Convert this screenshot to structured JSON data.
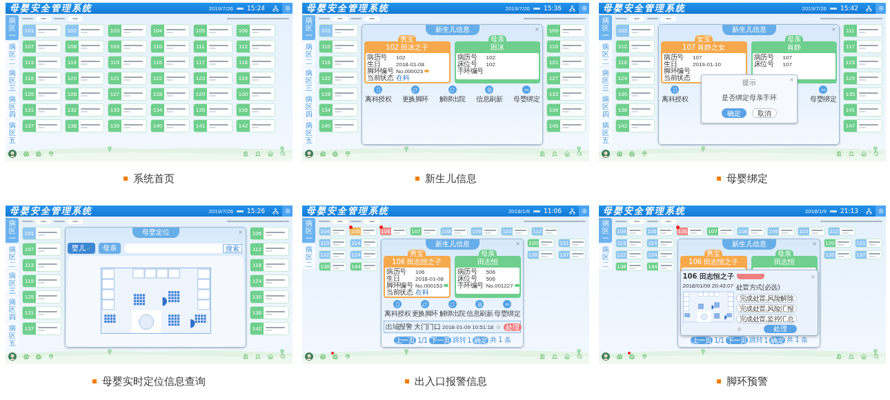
{
  "screens": [
    {
      "caption": "系统首页",
      "header": {
        "title": "母婴安全管理系统",
        "date": "2019/7/26",
        "time": "15:24"
      },
      "nav_alert": false,
      "wards": [
        {
          "label": "病区一",
          "selected": true
        },
        {
          "label": "病区二",
          "selected": false
        },
        {
          "label": "病区三",
          "selected": false
        },
        {
          "label": "病区四",
          "selected": false
        },
        {
          "label": "病区五",
          "selected": false
        }
      ],
      "left_columns": [
        [
          {
            "number": "101",
            "kind": "bound"
          },
          {
            "number": "107",
            "kind": "unbound"
          },
          {
            "number": "113",
            "kind": "unbound"
          },
          {
            "number": "119",
            "kind": "unbound"
          },
          {
            "number": "125",
            "kind": "unbound"
          },
          {
            "number": "131",
            "kind": "unbound"
          },
          {
            "number": "137",
            "kind": "unbound"
          }
        ],
        [
          {
            "number": "102",
            "kind": "bound"
          },
          {
            "number": "108",
            "kind": "unbound"
          },
          {
            "number": "114",
            "kind": "unbound"
          },
          {
            "number": "120",
            "kind": "unbound"
          },
          {
            "number": "126",
            "kind": "unbound"
          },
          {
            "number": "132",
            "kind": "unbound"
          },
          {
            "number": "138",
            "kind": "unbound"
          }
        ],
        [
          {
            "number": "103",
            "kind": "unbound"
          },
          {
            "number": "109",
            "kind": "unbound"
          },
          {
            "number": "115",
            "kind": "unbound"
          },
          {
            "number": "121",
            "kind": "unbound"
          },
          {
            "number": "127",
            "kind": "unbound"
          },
          {
            "number": "133",
            "kind": "unbound"
          },
          {
            "number": "139",
            "kind": "unbound"
          }
        ],
        [
          {
            "number": "104",
            "kind": "unbound"
          },
          {
            "number": "110",
            "kind": "unbound"
          },
          {
            "number": "116",
            "kind": "unbound"
          },
          {
            "number": "122",
            "kind": "unbound"
          },
          {
            "number": "128",
            "kind": "unbound"
          },
          {
            "number": "134",
            "kind": "unbound"
          },
          {
            "number": "140",
            "kind": "unbound"
          }
        ],
        [
          {
            "number": "105",
            "kind": "unbound"
          },
          {
            "number": "111",
            "kind": "unbound"
          },
          {
            "number": "117",
            "kind": "unbound"
          },
          {
            "number": "123",
            "kind": "unbound"
          },
          {
            "number": "129",
            "kind": "unbound"
          },
          {
            "number": "135",
            "kind": "unbound"
          },
          {
            "number": "141",
            "kind": "unbound"
          }
        ],
        [
          {
            "number": "106",
            "kind": "unbound"
          },
          {
            "number": "112",
            "kind": "unbound"
          },
          {
            "number": "118",
            "kind": "unbound"
          },
          {
            "number": "124",
            "kind": "unbound"
          },
          {
            "number": "130",
            "kind": "unbound"
          },
          {
            "number": "136",
            "kind": "unbound"
          },
          {
            "number": "142",
            "kind": "unbound"
          }
        ]
      ]
    },
    {
      "caption": "新生儿信息",
      "header": {
        "title": "母婴安全管理系统",
        "date": "2019/7/26",
        "time": "15:36"
      },
      "nav_alert": false,
      "wards": [
        {
          "label": "病区一",
          "selected": true
        },
        {
          "label": "病区二",
          "selected": false
        },
        {
          "label": "病区三",
          "selected": false
        },
        {
          "label": "病区四",
          "selected": false
        },
        {
          "label": "病区五",
          "selected": false
        }
      ],
      "left_columns": [
        [
          {
            "number": "101",
            "kind": "bound"
          },
          {
            "number": "110",
            "kind": "unbound"
          },
          {
            "number": "116",
            "kind": "unbound"
          },
          {
            "number": "122",
            "kind": "unbound"
          },
          {
            "number": "128",
            "kind": "unbound"
          },
          {
            "number": "134",
            "kind": "unbound"
          },
          {
            "number": "140",
            "kind": "unbound"
          }
        ]
      ],
      "dialog": {
        "kind": "newborn",
        "title": "新生儿信息",
        "baby": {
          "badge": "男宝",
          "name": "102 田冰之子",
          "fields": [
            {
              "label": "病历号",
              "value": "102"
            },
            {
              "label": "生日",
              "value": "2018-01-08"
            },
            {
              "label": "脚环编号",
              "value": "No.000023",
              "toggle_on": false
            },
            {
              "label": "当前状态",
              "value": "在科",
              "kind": "status"
            }
          ]
        },
        "mother": {
          "badge": "母亲",
          "name": "田冰",
          "fields": [
            {
              "label": "病历号",
              "value": "102"
            },
            {
              "label": "床位号",
              "value": "102"
            },
            {
              "label": "手环编号"
            }
          ]
        },
        "actions": [
          {
            "kind": "leave",
            "label": "离科授权"
          },
          {
            "kind": "swap",
            "label": "更换脚环"
          },
          {
            "kind": "discharge",
            "label": "解绑出院"
          },
          {
            "kind": "refresh",
            "label": "信息刷新"
          },
          {
            "kind": "bind",
            "label": "母婴绑定"
          }
        ]
      },
      "right_columns": [
        [
          {
            "number": "109",
            "kind": "unbound"
          },
          {
            "number": "115",
            "kind": "unbound"
          },
          {
            "number": "121",
            "kind": "unbound"
          },
          {
            "number": "127",
            "kind": "unbound"
          },
          {
            "number": "133",
            "kind": "unbound"
          },
          {
            "number": "139",
            "kind": "unbound"
          },
          {
            "number": "145",
            "kind": "unbound"
          }
        ]
      ]
    },
    {
      "caption": "母婴绑定",
      "header": {
        "title": "母婴安全管理系统",
        "date": "2019/7/26",
        "time": "15:42"
      },
      "nav_alert": false,
      "wards": [
        {
          "label": "病区一",
          "selected": true
        },
        {
          "label": "病区二",
          "selected": false
        },
        {
          "label": "病区三",
          "selected": false
        },
        {
          "label": "病区四",
          "selected": false
        },
        {
          "label": "病区五",
          "selected": false
        }
      ],
      "left_columns": [
        [
          {
            "number": "102",
            "kind": "bound"
          },
          {
            "number": "112",
            "kind": "unbound"
          },
          {
            "number": "118",
            "kind": "unbound"
          },
          {
            "number": "124",
            "kind": "unbound"
          },
          {
            "number": "130",
            "kind": "unbound"
          },
          {
            "number": "136",
            "kind": "unbound"
          },
          {
            "number": "142",
            "kind": "unbound"
          }
        ]
      ],
      "dialog": {
        "kind": "newborn",
        "title": "新生儿信息",
        "baby": {
          "badge": "女宝",
          "name": "107 肖静之女",
          "fields": [
            {
              "label": "病历号",
              "value": "107"
            },
            {
              "label": "生日",
              "value": "2019-01-10"
            },
            {
              "label": "脚环编号"
            },
            {
              "label": "当前状态"
            }
          ]
        },
        "mother": {
          "badge": "母亲",
          "name": "肖静",
          "fields": [
            {
              "label": "病历号",
              "value": "107"
            },
            {
              "label": "床位号",
              "value": "107"
            }
          ]
        },
        "actions": [
          {
            "kind": "leave",
            "label": "离科授权"
          },
          {
            "kind": "bind",
            "label": "母婴绑定"
          }
        ],
        "overlay": {
          "kind": "confirm",
          "title": "提示",
          "message": "是否绑定母亲手环",
          "buttons": [
            {
              "label": "确定",
              "primary": true
            },
            {
              "label": "取消",
              "primary": false
            }
          ]
        }
      },
      "right_columns": [
        [
          {
            "number": "111",
            "kind": "unbound"
          },
          {
            "number": "117",
            "kind": "unbound"
          },
          {
            "number": "123",
            "kind": "unbound"
          },
          {
            "number": "129",
            "kind": "unbound"
          },
          {
            "number": "135",
            "kind": "unbound"
          },
          {
            "number": "141",
            "kind": "unbound"
          },
          {
            "number": "147",
            "kind": "unbound"
          }
        ]
      ]
    },
    {
      "caption": "母婴实时定位信息查询",
      "header": {
        "title": "母婴安全管理系统",
        "date": "2019/7/26",
        "time": "15:26"
      },
      "nav_alert": false,
      "wards": [
        {
          "label": "病区一",
          "selected": true
        },
        {
          "label": "病区二",
          "selected": false
        },
        {
          "label": "病区三",
          "selected": false
        },
        {
          "label": "病区四",
          "selected": false
        },
        {
          "label": "病区五",
          "selected": false
        }
      ],
      "left_columns": [
        [
          {
            "number": "101",
            "kind": "bound"
          },
          {
            "number": "107",
            "kind": "unbound"
          },
          {
            "number": "113",
            "kind": "unbound"
          },
          {
            "number": "119",
            "kind": "unbound"
          },
          {
            "number": "125",
            "kind": "unbound"
          },
          {
            "number": "131",
            "kind": "unbound"
          },
          {
            "number": "137",
            "kind": "unbound"
          }
        ]
      ],
      "dialog": {
        "kind": "locate",
        "title": "母婴定位",
        "tabs": [
          {
            "label": "婴儿",
            "selected": true
          },
          {
            "label": "母亲",
            "selected": false
          }
        ],
        "search_button": "搜索"
      },
      "right_columns": [
        [
          {
            "number": "106",
            "kind": "unbound"
          },
          {
            "number": "112",
            "kind": "unbound"
          },
          {
            "number": "118",
            "kind": "unbound"
          },
          {
            "number": "124",
            "kind": "unbound"
          },
          {
            "number": "130",
            "kind": "unbound"
          },
          {
            "number": "136",
            "kind": "unbound"
          },
          {
            "number": "142",
            "kind": "unbound"
          }
        ]
      ]
    },
    {
      "caption": "出入口报警信息",
      "header": {
        "title": "母婴安全管理系统",
        "date": "2018/1/9",
        "time": "11:06"
      },
      "nav_alert": true,
      "wards": [
        {
          "label": "病区一",
          "selected": true
        },
        {
          "label": "病区二",
          "selected": false
        }
      ],
      "top_beds": [
        {
          "number": "104",
          "kind": "bound",
          "alert": false
        },
        {
          "number": "105",
          "kind": "warning",
          "alert": true
        },
        {
          "number": "106",
          "kind": "alarm",
          "alert": true
        },
        {
          "number": "107",
          "kind": "unbound",
          "alert": false
        },
        {
          "number": "108",
          "kind": "bound",
          "alert": false
        },
        {
          "number": "109",
          "kind": "bound",
          "alert": false
        },
        {
          "number": "110",
          "kind": "bound",
          "alert": false
        },
        {
          "number": "112",
          "kind": "bound",
          "alert": false
        }
      ],
      "left_columns": [
        [
          {
            "number": "113",
            "kind": "bound"
          },
          {
            "number": "122",
            "kind": "bound"
          },
          {
            "number": "138",
            "kind": "unbound"
          }
        ],
        [
          {
            "number": "114",
            "kind": "bound"
          },
          {
            "number": "124",
            "kind": "bound"
          },
          {
            "number": "144",
            "kind": "unbound"
          }
        ]
      ],
      "dialog": {
        "kind": "newborn",
        "title": "新生儿信息",
        "baby": {
          "badge": "男宝",
          "name": "106 田志恒之子",
          "fields": [
            {
              "label": "病历号",
              "value": "106"
            },
            {
              "label": "生日",
              "value": "2018-01-08"
            },
            {
              "label": "脚环编号",
              "value": "No.000153",
              "toggle_on": true
            },
            {
              "label": "当前状态",
              "value": "在科",
              "kind": "status"
            }
          ]
        },
        "mother": {
          "badge": "母亲",
          "name": "田志恒",
          "fields": [
            {
              "label": "病历号",
              "value": "506"
            },
            {
              "label": "床位号",
              "value": "506"
            },
            {
              "label": "手环编号",
              "value": "No.001227",
              "toggle_on": true
            }
          ]
        },
        "actions": [
          {
            "kind": "leave",
            "label": "离科授权"
          },
          {
            "kind": "swap",
            "label": "更换脚环"
          },
          {
            "kind": "discharge",
            "label": "解绑出院"
          },
          {
            "kind": "refresh",
            "label": "信息刷新"
          },
          {
            "kind": "bind",
            "label": "母婴绑定"
          }
        ],
        "alarm_rows": [
          {
            "type": "出域报警",
            "place": "大门门口",
            "time": "2018-01-09 10:51:18",
            "action": "处理"
          }
        ],
        "pager": {
          "prev": "上一页",
          "page": "1/1",
          "next": "下一页",
          "jump": "跳转",
          "jump_value": "1",
          "go": "确定",
          "total": "共 1 条"
        }
      },
      "right_columns": [
        [
          {
            "number": "120",
            "kind": "unbound"
          },
          {
            "number": "135",
            "kind": "bound"
          }
        ],
        [
          {
            "number": "121",
            "kind": "bound"
          },
          {
            "number": "137",
            "kind": "bound"
          }
        ]
      ]
    },
    {
      "caption": "脚环预警",
      "header": {
        "title": "母婴安全管理系统",
        "date": "2018/1/9",
        "time": "21:13"
      },
      "nav_alert": true,
      "wards": [
        {
          "label": "病区一",
          "selected": true
        },
        {
          "label": "病区二",
          "selected": false
        }
      ],
      "top_beds": [
        {
          "number": "104",
          "kind": "bound",
          "alert": false
        },
        {
          "number": "105",
          "kind": "bound",
          "alert": false
        },
        {
          "number": "106",
          "kind": "alarm",
          "alert": true
        },
        {
          "number": "107",
          "kind": "unbound",
          "alert": false
        },
        {
          "number": "108",
          "kind": "bound",
          "alert": false
        },
        {
          "number": "109",
          "kind": "bound",
          "alert": false
        },
        {
          "number": "110",
          "kind": "bound",
          "alert": false
        },
        {
          "number": "112",
          "kind": "bound",
          "alert": false
        }
      ],
      "left_columns": [
        [
          {
            "number": "113",
            "kind": "bound"
          },
          {
            "number": "122",
            "kind": "bound"
          },
          {
            "number": "138",
            "kind": "unbound"
          }
        ],
        [
          {
            "number": "114",
            "kind": "bound"
          },
          {
            "number": "124",
            "kind": "bound"
          },
          {
            "number": "144",
            "kind": "unbound"
          }
        ]
      ],
      "dialog": {
        "kind": "newborn",
        "title": "新生儿信息",
        "baby": {
          "badge": "男宝",
          "name": "106 田志恒之子"
        },
        "mother": {
          "badge": "母亲",
          "name": "田志恒"
        },
        "pager": {
          "prev": "上一页",
          "page": "1/1",
          "next": "下一页",
          "jump": "跳转",
          "jump_value": "1",
          "go": "确定",
          "total": "共 1 条"
        },
        "overlay": {
          "kind": "alarm",
          "title": "106 田志恒之子",
          "time": "2018/01/09 20:43:07",
          "prompt": "处置方式(必选)",
          "options": [
            "完成处置,风险解除",
            "完成处置,风险汇报",
            "完成处置,监控汇总"
          ],
          "button": "处理"
        }
      },
      "right_columns": [
        [
          {
            "number": "120",
            "kind": "unbound"
          },
          {
            "number": "135",
            "kind": "bound"
          }
        ],
        [
          {
            "number": "121",
            "kind": "bound"
          },
          {
            "number": "137",
            "kind": "bound"
          }
        ]
      ]
    }
  ]
}
